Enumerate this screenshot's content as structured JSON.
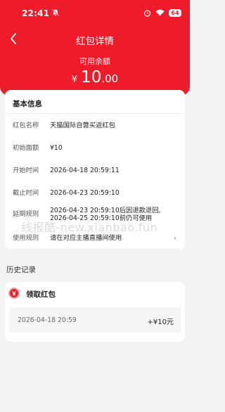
{
  "status_bar": {
    "time": "22:41",
    "battery": "64"
  },
  "header": {
    "title": "红包详情",
    "balance_label": "可用余额",
    "currency": "¥",
    "amount_int": "10",
    "amount_dec": ".00"
  },
  "info": {
    "title": "基本信息",
    "rows": [
      {
        "key": "红包名称",
        "value": "天猫国际自营买返红包"
      },
      {
        "key": "初始面额",
        "value": "¥10"
      },
      {
        "key": "开始时间",
        "value": "2026-04-18 20:59:11"
      },
      {
        "key": "截止时间",
        "value": "2026-04-23 20:59:10"
      },
      {
        "key": "延期规则",
        "value": "2026-04-23 20:59:10后因退款退回,",
        "value2": "2026-04-25 20:59:10前仍可使用"
      },
      {
        "key": "使用规则",
        "value": "请在对应主播直播间使用",
        "arrow": "›"
      }
    ]
  },
  "history": {
    "title": "历史记录",
    "record_name": "领取红包",
    "record_date": "2026-04-18 20:59",
    "record_amount": "+¥10元"
  },
  "watermark": "线报酷-new.xianbao.fun",
  "colors": {
    "brand_red": "#ee1b2b",
    "background": "#f3f3f3"
  }
}
